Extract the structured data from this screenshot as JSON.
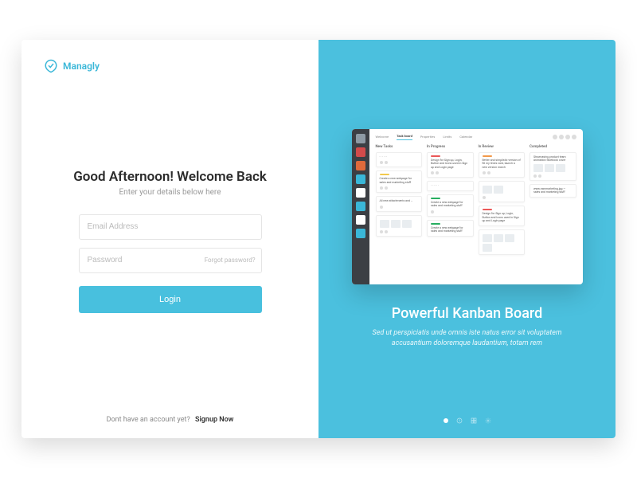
{
  "brand": {
    "name": "Managly"
  },
  "login": {
    "heading": "Good Afternoon! Welcome Back",
    "sub": "Enter your details below here",
    "email_placeholder": "Email Address",
    "password_placeholder": "Password",
    "forgot": "Forgot password?",
    "login_btn": "Login",
    "signup_prompt": "Dont have an account yet?",
    "signup_link": "Signup Now"
  },
  "promo": {
    "title": "Powerful Kanban Board",
    "desc": "Sed ut perspiciatis unde omnis iste natus error sit voluptatem accusantium doloremque laudantium, totam rem",
    "board": {
      "tabs": [
        "Welcome",
        "Task board",
        "Properties",
        "Limits",
        "Calendar"
      ],
      "columns": [
        {
          "title": "New Tasks"
        },
        {
          "title": "In Progress"
        },
        {
          "title": "In Review"
        },
        {
          "title": "Completed"
        }
      ],
      "card_text_a": "Create a new webpage for sales and marketing stuff",
      "card_text_b": "Design for Sign up, Login, Button and Icons used in Sign up and Login page",
      "card_text_c": "Better and simplistic version of fill my times card, launch a new version march",
      "card_text_d": "Showcasing product team animation facebook cover"
    }
  },
  "colors": {
    "accent": "#4BC0DE",
    "rail_icons": [
      "#8e9aa4",
      "#d34b4b",
      "#e06a3b",
      "#3AB7D8",
      "#ffffff",
      "#3AB7D8",
      "#ffffff",
      "#3AB7D8"
    ]
  }
}
